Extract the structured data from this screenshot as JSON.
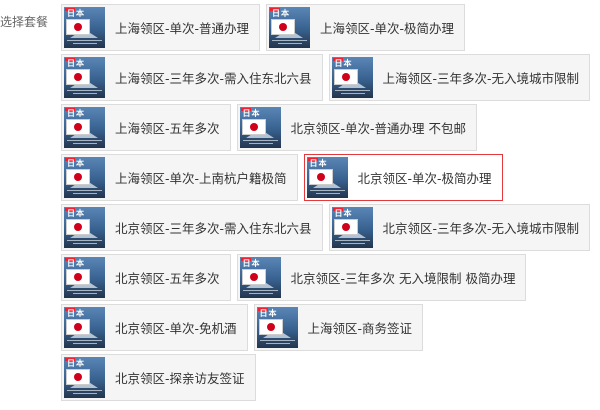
{
  "label": "选择套餐",
  "thumb_text": "日本",
  "accent_color": "#e4393c",
  "rows": [
    [
      {
        "text": "上海领区-单次-普通办理"
      },
      {
        "text": "上海领区-单次-极简办理"
      }
    ],
    [
      {
        "text": "上海领区-三年多次-需入住东北六县"
      },
      {
        "text": "上海领区-三年多次-无入境城市限制"
      }
    ],
    [
      {
        "text": "上海领区-五年多次"
      },
      {
        "text": "北京领区-单次-普通办理 不包邮"
      }
    ],
    [
      {
        "text": "上海领区-单次-上南杭户籍极简"
      },
      {
        "text": "北京领区-单次-极简办理",
        "selected": true
      }
    ],
    [
      {
        "text": "北京领区-三年多次-需入住东北六县"
      },
      {
        "text": "北京领区-三年多次-无入境城市限制"
      }
    ],
    [
      {
        "text": "北京领区-五年多次"
      },
      {
        "text": "北京领区-三年多次 无入境限制 极简办理"
      }
    ],
    [
      {
        "text": "北京领区-单次-免机酒"
      },
      {
        "text": "上海领区-商务签证"
      }
    ],
    [
      {
        "text": "北京领区-探亲访友签证"
      }
    ]
  ]
}
